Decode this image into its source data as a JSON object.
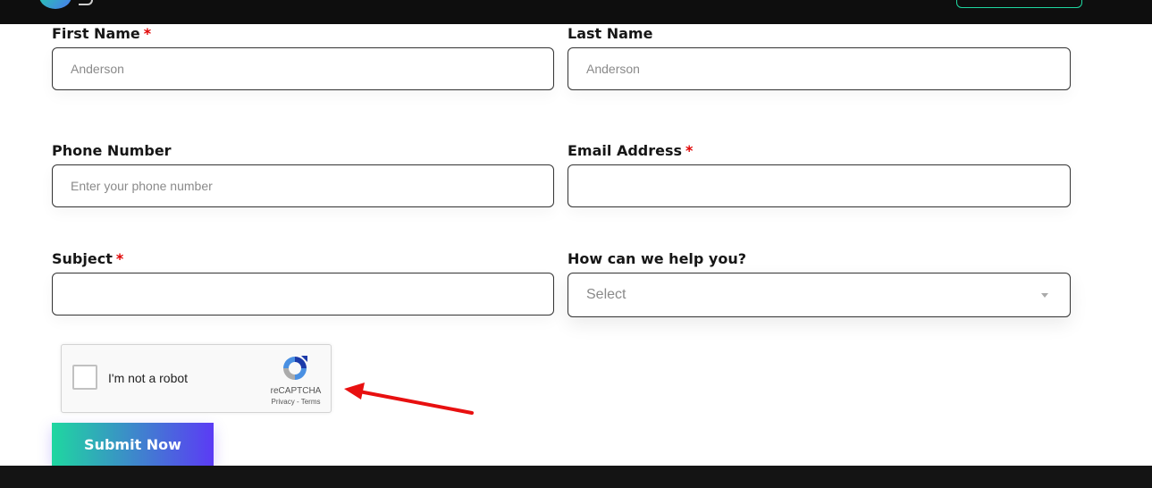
{
  "form": {
    "first_name": {
      "label": "First Name",
      "required_mark": "*",
      "placeholder": "Anderson"
    },
    "last_name": {
      "label": "Last Name",
      "placeholder": "Anderson"
    },
    "phone": {
      "label": "Phone Number",
      "placeholder": "Enter your phone number"
    },
    "email": {
      "label": "Email Address",
      "required_mark": "*",
      "placeholder": ""
    },
    "subject": {
      "label": "Subject",
      "required_mark": "*",
      "placeholder": ""
    },
    "help": {
      "label": "How can we help you?",
      "selected": "Select"
    },
    "recaptcha": {
      "label": "I'm not a robot",
      "brand": "reCAPTCHA",
      "privacy": "Privacy",
      "separator": " - ",
      "terms": "Terms"
    },
    "submit_label": "Submit Now"
  },
  "colors": {
    "required": "#e00000",
    "submit_gradient_start": "#1fd7a0",
    "submit_gradient_end": "#5b3bf5",
    "annotation_arrow": "#e81010",
    "header_bg": "#0e0e0e"
  }
}
